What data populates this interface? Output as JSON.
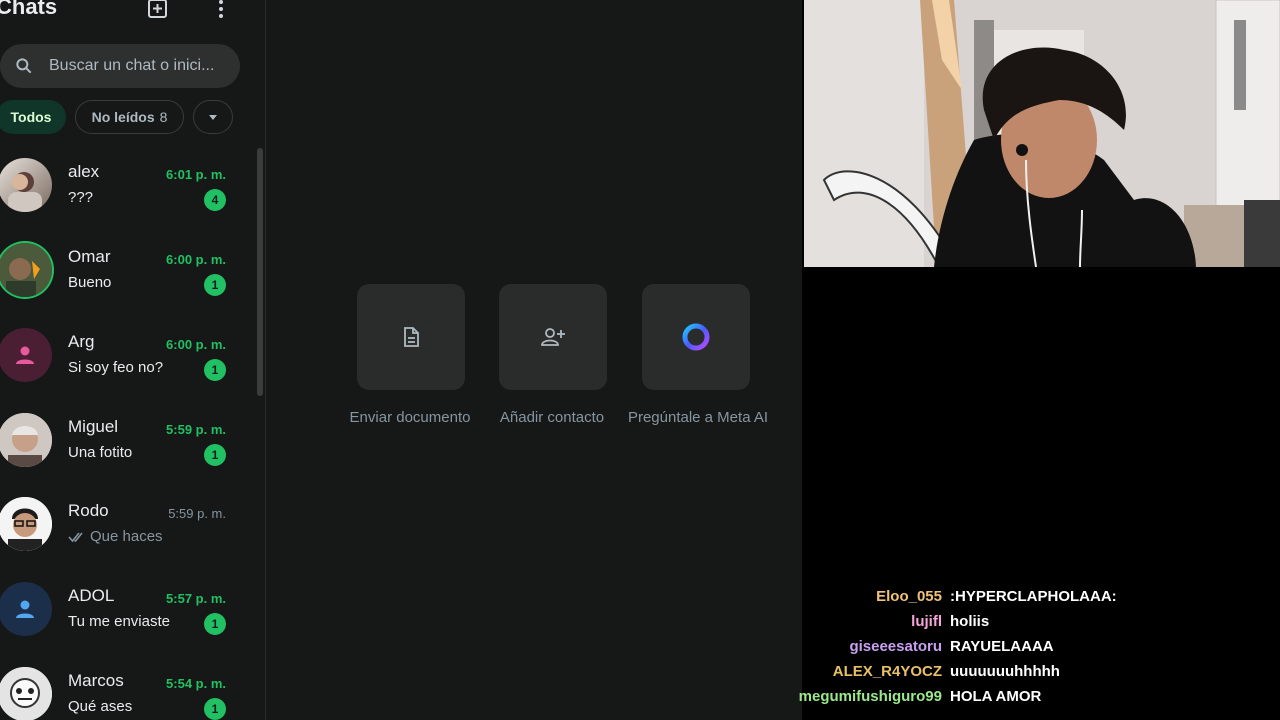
{
  "sidebar": {
    "title": "Chats",
    "search_placeholder": "Buscar un chat o inici...",
    "filters": {
      "all": "Todos",
      "unread": "No leídos",
      "unread_count": "8"
    },
    "chats": [
      {
        "name": "alex",
        "time": "6:01 p. m.",
        "message": "???",
        "unread": "4"
      },
      {
        "name": "Omar",
        "time": "6:00 p. m.",
        "message": "Bueno",
        "unread": "1"
      },
      {
        "name": "Arg",
        "time": "6:00 p. m.",
        "message": "Si soy feo no?",
        "unread": "1"
      },
      {
        "name": "Miguel",
        "time": "5:59 p. m.",
        "message": "Una fotito",
        "unread": "1"
      },
      {
        "name": "Rodo",
        "time": "5:59 p. m.",
        "message": "Que haces",
        "unread": ""
      },
      {
        "name": "ADOL",
        "time": "5:57 p. m.",
        "message": "Tu me enviaste",
        "unread": "1"
      },
      {
        "name": "Marcos",
        "time": "5:54 p. m.",
        "message": "Qué ases",
        "unread": "1"
      }
    ]
  },
  "main": {
    "actions": [
      {
        "label": "Enviar documento",
        "icon": "document-icon"
      },
      {
        "label": "Añadir contacto",
        "icon": "add-contact-icon"
      },
      {
        "label": "Pregúntale a Meta AI",
        "icon": "meta-ai-icon"
      }
    ]
  },
  "stream_chat": [
    {
      "user": "Eloo_055",
      "message": ":HYPERCLAPHOLAAA:",
      "color": "#f0c27a"
    },
    {
      "user": "lujifl",
      "message": "holiis",
      "color": "#f4a6d9"
    },
    {
      "user": "giseeesatoru",
      "message": "RAYUELAAAA",
      "color": "#c9a0f0"
    },
    {
      "user": "ALEX_R4YOCZ",
      "message": "uuuuuuuhhhhh",
      "color": "#e8c06a"
    },
    {
      "user": "megumifushiguro99",
      "message": "HOLA AMOR",
      "color": "#9be88c"
    }
  ],
  "colors": {
    "accent_green": "#21c063",
    "sidebar_bg": "#161717",
    "panel_bg": "#2a2b2b"
  }
}
